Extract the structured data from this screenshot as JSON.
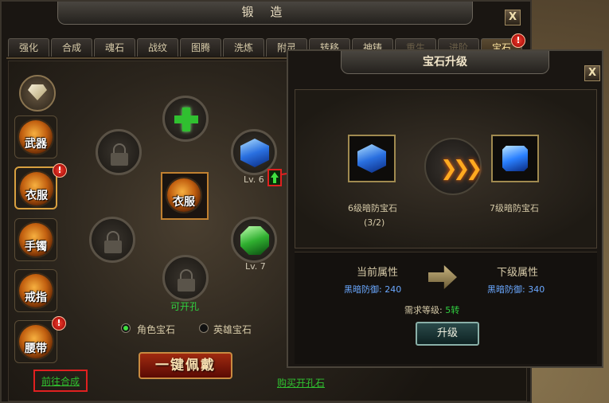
{
  "forge": {
    "title": "锻 造",
    "close_label": "X",
    "tabs": [
      "强化",
      "合成",
      "魂石",
      "战纹",
      "图腾",
      "洗炼",
      "附灵",
      "转移",
      "神铸",
      "重生",
      "进阶",
      "宝石"
    ],
    "tab_badge": "!",
    "slots": [
      {
        "label": "武器",
        "badge": false
      },
      {
        "label": "衣服",
        "badge": true,
        "selected": true
      },
      {
        "label": "手镯",
        "badge": false
      },
      {
        "label": "戒指",
        "badge": false
      },
      {
        "label": "腰带",
        "badge": true
      }
    ],
    "slot_badge": "!",
    "center_label": "衣服",
    "gem_blue_level": "Lv. 6",
    "gem_green_level": "Lv. 7",
    "can_open": "可开孔",
    "radio_role": "角色宝石",
    "radio_hero": "英雄宝石",
    "equip_button": "一键佩戴",
    "link_goto_compose": "前往合成",
    "link_buy_stone": "购买开孔石"
  },
  "upgrade": {
    "title": "宝石升级",
    "close_label": "X",
    "from_gem": "6级暗防宝石",
    "from_count": "(3/2)",
    "to_gem": "7级暗防宝石",
    "current_header": "当前属性",
    "next_header": "下级属性",
    "current_stat": "黑暗防御: 240",
    "next_stat": "黑暗防御: 340",
    "req_label": "需求等级: ",
    "req_value": "5转",
    "button": "升级"
  },
  "colors": {
    "accent_gold": "#c88a40",
    "link_green": "#30c030",
    "stat_blue": "#6aa8ff",
    "highlight_red": "#e02020"
  }
}
